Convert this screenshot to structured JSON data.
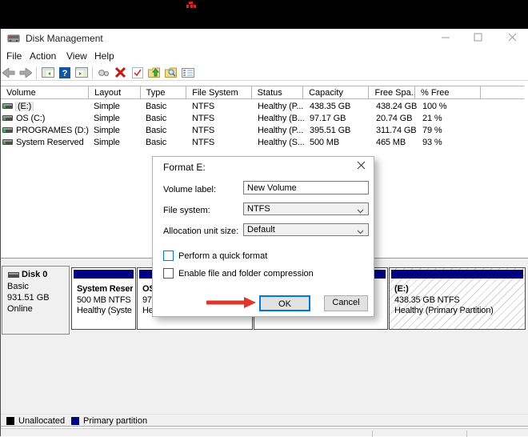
{
  "screen": {
    "red_glyph_color": "#d22222"
  },
  "window": {
    "title": "Disk Management",
    "caption": {
      "minimize": "—",
      "maximize": "",
      "close": "✕"
    },
    "menu": [
      "File",
      "Action",
      "View",
      "Help"
    ],
    "toolbar": [
      "back",
      "forward",
      "show-console-tree",
      "help",
      "show-action-pane",
      "view",
      "delete",
      "check",
      "export-up",
      "find",
      "properties"
    ],
    "volume_table": {
      "columns": [
        "Volume",
        "Layout",
        "Type",
        "File System",
        "Status",
        "Capacity",
        "Free Spa...",
        "% Free",
        ""
      ],
      "rows": [
        {
          "volume": "(E:)",
          "layout": "Simple",
          "type": "Basic",
          "fs": "NTFS",
          "status": "Healthy (P...",
          "capacity": "438.35 GB",
          "free": "438.24 GB",
          "pct": "100 %"
        },
        {
          "volume": "OS (C:)",
          "layout": "Simple",
          "type": "Basic",
          "fs": "NTFS",
          "status": "Healthy (B...",
          "capacity": "97.17 GB",
          "free": "20.74 GB",
          "pct": "21 %"
        },
        {
          "volume": "PROGRAMES (D:)",
          "layout": "Simple",
          "type": "Basic",
          "fs": "NTFS",
          "status": "Healthy (P...",
          "capacity": "395.51 GB",
          "free": "311.74 GB",
          "pct": "79 %"
        },
        {
          "volume": "System Reserved",
          "layout": "Simple",
          "type": "Basic",
          "fs": "NTFS",
          "status": "Healthy (S...",
          "capacity": "500 MB",
          "free": "465 MB",
          "pct": "93 %"
        }
      ]
    },
    "disk0": {
      "name": "Disk 0",
      "type": "Basic",
      "size": "931.51 GB",
      "status": "Online",
      "partitions": [
        {
          "l1": "System Reser",
          "l2": "500 MB NTFS",
          "l3": "Healthy (Syste"
        },
        {
          "l1": "OS",
          "l2": "97",
          "l3": "He"
        },
        {
          "l1": "",
          "l2": "",
          "l3": ""
        },
        {
          "l1": "(E:)",
          "l2": "438.35 GB NTFS",
          "l3": "Healthy (Primary Partition)"
        }
      ]
    },
    "legend": [
      {
        "label": "Unallocated",
        "color": "#000000"
      },
      {
        "label": "Primary partition",
        "color": "#000080"
      }
    ]
  },
  "dialog": {
    "title": "Format E:",
    "close": "✕",
    "fields": [
      {
        "label": "Volume label:",
        "value": "New Volume"
      },
      {
        "label": "File system:",
        "value": "NTFS"
      },
      {
        "label": "Allocation unit size:",
        "value": "Default"
      }
    ],
    "checkboxes": [
      {
        "label": "Perform a quick format"
      },
      {
        "label": "Enable file and folder compression"
      }
    ],
    "buttons": {
      "ok": "OK",
      "cancel": "Cancel"
    },
    "arrow_color": "#dd372c"
  }
}
